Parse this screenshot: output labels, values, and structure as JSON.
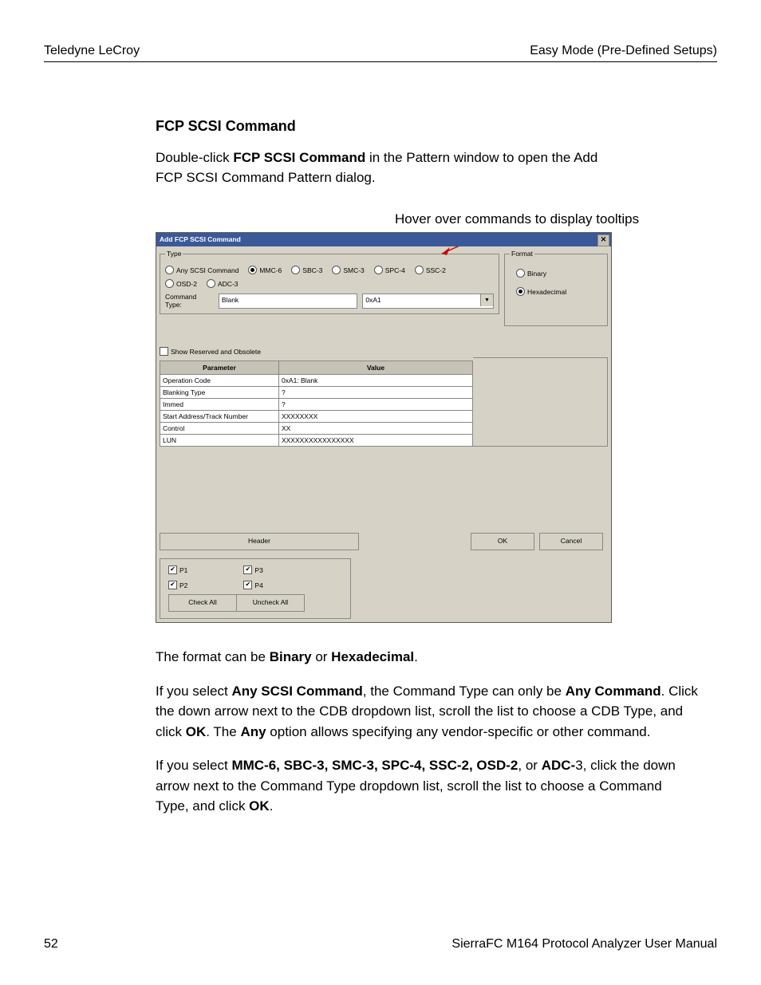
{
  "header": {
    "left": "Teledyne LeCroy",
    "right": "Easy Mode (Pre-Defined Setups)"
  },
  "section": {
    "title": "FCP SCSI Command"
  },
  "intro": {
    "pre": "Double-click ",
    "b": "FCP SCSI Command",
    "post": " in the Pattern window to open the Add FCP SCSI Command Pattern dialog."
  },
  "caption": "Hover over commands to display tooltips",
  "dlg": {
    "title": "Add FCP SCSI Command",
    "group_type": "Type",
    "group_format": "Format",
    "radios_type": [
      {
        "label": "Any SCSI Command",
        "sel": false
      },
      {
        "label": "MMC-6",
        "sel": true
      },
      {
        "label": "SBC-3",
        "sel": false
      },
      {
        "label": "SMC-3",
        "sel": false
      },
      {
        "label": "SPC-4",
        "sel": false
      },
      {
        "label": "SSC-2",
        "sel": false
      },
      {
        "label": "OSD-2",
        "sel": false
      },
      {
        "label": "ADC-3",
        "sel": false
      }
    ],
    "radios_format": [
      {
        "label": "Binary",
        "sel": false
      },
      {
        "label": "Hexadecimal",
        "sel": true
      }
    ],
    "cmdtype_label": "Command Type:",
    "cmdtype_value": "Blank",
    "cmdtype_code": "0xA1",
    "show_reserved": "Show Reserved and Obsolete",
    "table": {
      "headers": [
        "Parameter",
        "Value"
      ],
      "rows": [
        [
          "Operation Code",
          "0xA1: Blank"
        ],
        [
          "Blanking Type",
          "?"
        ],
        [
          "Immed",
          "?"
        ],
        [
          "Start Address/Track Number",
          "XXXXXXXX"
        ],
        [
          "Control",
          "XX"
        ],
        [
          "LUN",
          "XXXXXXXXXXXXXXXX"
        ]
      ]
    },
    "header_btn": "Header",
    "ok": "OK",
    "cancel": "Cancel",
    "ports": [
      {
        "label": "P1",
        "chk": true
      },
      {
        "label": "P3",
        "chk": true
      },
      {
        "label": "P2",
        "chk": true
      },
      {
        "label": "P4",
        "chk": true
      }
    ],
    "check_all": "Check All",
    "uncheck_all": "Uncheck All"
  },
  "para1": {
    "t1": "The format can be ",
    "b1": "Binary",
    "t2": " or ",
    "b2": "Hexadecimal",
    "t3": "."
  },
  "para2": {
    "t1": "If you select ",
    "b1": "Any SCSI Command",
    "t2": ", the Command Type can only be ",
    "b2": "Any Command",
    "t3": ". Click the down arrow next to the CDB dropdown list, scroll the list to choose a CDB Type, and click ",
    "b3": "OK",
    "t4": ". The ",
    "b4": "Any",
    "t5": " option allows specifying any vendor-specific or other command."
  },
  "para3": {
    "t1": "If you select ",
    "b1": "MMC-6, SBC-3, SMC-3, SPC-4, SSC-2, OSD-2",
    "t2": ", or ",
    "b2": "ADC-",
    "t3": "3, click the down arrow next to the Command Type dropdown list, scroll the list to choose a Command Type, and click ",
    "b3": "OK",
    "t4": "."
  },
  "footer": {
    "page": "52",
    "title": "SierraFC M164 Protocol Analyzer User Manual"
  }
}
